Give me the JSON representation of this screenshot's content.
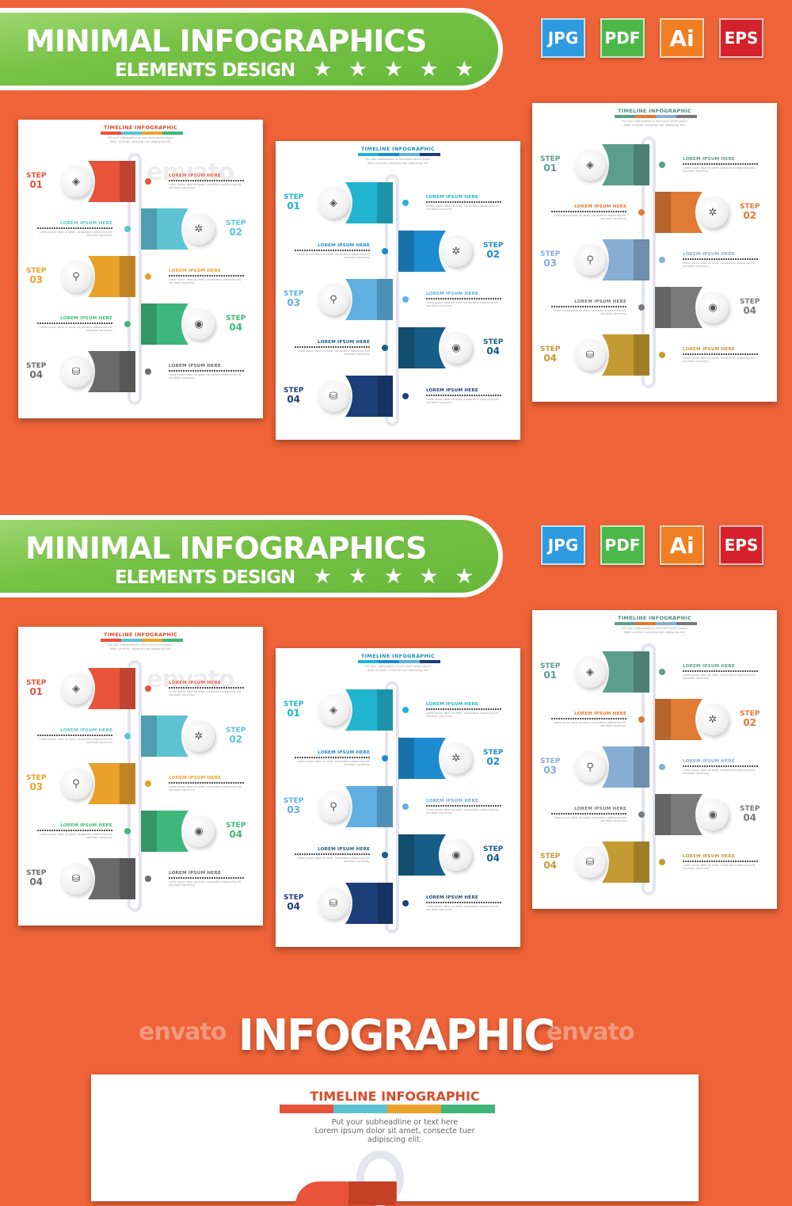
{
  "banner": {
    "title": "MINIMAL INFOGRAPHICS",
    "subtitle": "ELEMENTS DESIGN",
    "stars": "★ ★ ★ ★ ★",
    "rating": 5
  },
  "badges": [
    {
      "label": "JPG",
      "color": "#2e9ae0"
    },
    {
      "label": "PDF",
      "color": "#4cb848"
    },
    {
      "label": "Ai",
      "color": "#f07e22"
    },
    {
      "label": "EPS",
      "color": "#d4222d"
    }
  ],
  "watermark": "envato",
  "cards": [
    {
      "title": "TIMELINE INFOGRAPHIC",
      "title_color": "#d94b2b",
      "subtitle": "Put your subheadline or text here Lorem ipsum dolor sit amet, consecte tuer adipiscing elit.",
      "bar_colors": [
        "#e8533a",
        "#5ec3d3",
        "#eaa12a",
        "#3fb77a"
      ],
      "steps": [
        {
          "step": "STEP",
          "num": "01",
          "label": "LOREM IPSUM HERE",
          "text": "Lorem ipsum dolor sit amet, consectetur adipiscing elit, sed diam nonummy",
          "color": "#e8533a",
          "icon": "diamond-icon",
          "glyph": "◈"
        },
        {
          "step": "STEP",
          "num": "02",
          "label": "LOREM IPSUM HERE",
          "text": "Lorem ipsum dolor sit amet, consectetur adipiscing elit, sed diam nonummy",
          "color": "#5ec3d3",
          "icon": "gear-icon",
          "glyph": "✲"
        },
        {
          "step": "STEP",
          "num": "03",
          "label": "LOREM IPSUM HERE",
          "text": "Lorem ipsum dolor sit amet, consectetur adipiscing elit, sed diam nonummy",
          "color": "#eaa12a",
          "icon": "people-icon",
          "glyph": "⚲"
        },
        {
          "step": "STEP",
          "num": "04",
          "label": "LOREM IPSUM HERE",
          "text": "Lorem ipsum dolor sit amet, consectetur adipiscing elit, sed diam nonummy",
          "color": "#3fb77a",
          "icon": "eye-icon",
          "glyph": "◉"
        },
        {
          "step": "STEP",
          "num": "04",
          "label": "LOREM IPSUM HERE",
          "text": "Lorem ipsum dolor sit amet, consectetur adipiscing elit, sed diam nonummy",
          "color": "#6b6b6b",
          "icon": "database-icon",
          "glyph": "⛁"
        }
      ]
    },
    {
      "title": "TIMELINE INFOGRAPHIC",
      "title_color": "#1f8fb5",
      "subtitle": "Put your subheadline or text here Lorem ipsum dolor sit amet, consecte tuer adipiscing elit.",
      "bar_colors": [
        "#21b5d0",
        "#1c8bcf",
        "#5fb0e0",
        "#1c3f7a"
      ],
      "steps": [
        {
          "step": "STEP",
          "num": "01",
          "label": "LOREM IPSUM HERE",
          "text": "Lorem ipsum dolor sit amet, consectetur adipiscing elit, sed diam nonummy",
          "color": "#21b5d0",
          "icon": "diamond-icon",
          "glyph": "◈"
        },
        {
          "step": "STEP",
          "num": "02",
          "label": "LOREM IPSUM HERE",
          "text": "Lorem ipsum dolor sit amet, consectetur adipiscing elit, sed diam nonummy",
          "color": "#1c8bcf",
          "icon": "gear-icon",
          "glyph": "✲"
        },
        {
          "step": "STEP",
          "num": "03",
          "label": "LOREM IPSUM HERE",
          "text": "Lorem ipsum dolor sit amet, consectetur adipiscing elit, sed diam nonummy",
          "color": "#5fb0e0",
          "icon": "people-icon",
          "glyph": "⚲"
        },
        {
          "step": "STEP",
          "num": "04",
          "label": "LOREM IPSUM HERE",
          "text": "Lorem ipsum dolor sit amet, consectetur adipiscing elit, sed diam nonummy",
          "color": "#165e87",
          "icon": "eye-icon",
          "glyph": "◉"
        },
        {
          "step": "STEP",
          "num": "04",
          "label": "LOREM IPSUM HERE",
          "text": "Lorem ipsum dolor sit amet, consectetur adipiscing elit, sed diam nonummy",
          "color": "#1c3f7a",
          "icon": "database-icon",
          "glyph": "⛁"
        }
      ]
    },
    {
      "title": "TIMELINE INFOGRAPHIC",
      "title_color": "#4b8c7d",
      "subtitle": "Put your subheadline or text here Lorem ipsum dolor sit amet, consecte tuer adipiscing elit.",
      "bar_colors": [
        "#5c9e8c",
        "#e07a34",
        "#86aed3",
        "#7a7a7a"
      ],
      "steps": [
        {
          "step": "STEP",
          "num": "01",
          "label": "LOREM IPSUM HERE",
          "text": "Lorem ipsum dolor sit amet, consectetur adipiscing elit, sed diam nonummy",
          "color": "#5c9e8c",
          "icon": "diamond-icon",
          "glyph": "◈"
        },
        {
          "step": "STEP",
          "num": "02",
          "label": "LOREM IPSUM HERE",
          "text": "Lorem ipsum dolor sit amet, consectetur adipiscing elit, sed diam nonummy",
          "color": "#e07a34",
          "icon": "gear-icon",
          "glyph": "✲"
        },
        {
          "step": "STEP",
          "num": "03",
          "label": "LOREM IPSUM HERE",
          "text": "Lorem ipsum dolor sit amet, consectetur adipiscing elit, sed diam nonummy",
          "color": "#86aed3",
          "icon": "people-icon",
          "glyph": "⚲"
        },
        {
          "step": "STEP",
          "num": "04",
          "label": "LOREM IPSUM HERE",
          "text": "Lorem ipsum dolor sit amet, consectetur adipiscing elit, sed diam nonummy",
          "color": "#7a7a7a",
          "icon": "eye-icon",
          "glyph": "◉"
        },
        {
          "step": "STEP",
          "num": "04",
          "label": "LOREM IPSUM HERE",
          "text": "Lorem ipsum dolor sit amet, consectetur adipiscing elit, sed diam nonummy",
          "color": "#c49a32",
          "icon": "database-icon",
          "glyph": "⛁"
        }
      ]
    }
  ],
  "bottom": {
    "big_title": "INFOGRAPHIC",
    "card_title": "TIMELINE INFOGRAPHIC",
    "bar_colors": [
      "#e8533a",
      "#5ec3d3",
      "#eaa12a",
      "#3fb77a"
    ],
    "subtitle_lines": [
      "Put your subheadline or text here",
      "Lorem ipsum dolor sit amet, consecte tuer",
      "adipiscing elit."
    ]
  }
}
